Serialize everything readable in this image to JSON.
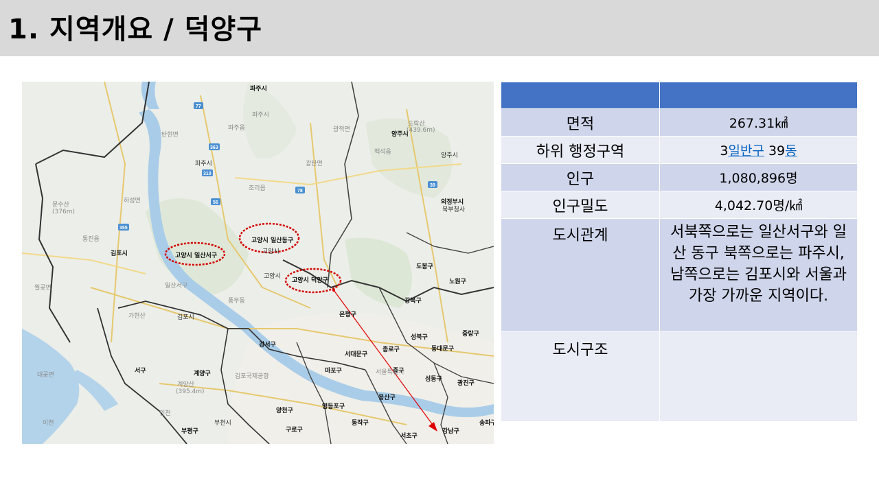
{
  "title": "1. 지역개요 / 덕양구",
  "map": {
    "highlight_labels": [
      "고양시 일산동구",
      "고양시 일산서구",
      "고양시 덕양구"
    ],
    "place_labels": [
      "파주시",
      "파주시",
      "파주읍",
      "광적면",
      "양주시",
      "도락산",
      "(439.6m)",
      "백석읍",
      "양주시",
      "광탄면",
      "탄현면",
      "파주시",
      "조리읍",
      "하성면",
      "문수산",
      "(376m)",
      "통진읍",
      "김포시",
      "고양시",
      "일산서구",
      "고양시",
      "노원구",
      "강북구",
      "도봉구",
      "의정부시",
      "북부청사",
      "은평구",
      "성북구",
      "중랑구",
      "동대문구",
      "종로구",
      "서대문구",
      "마포구",
      "중구",
      "성동구",
      "광진구",
      "용산구",
      "강서구",
      "양천구",
      "영등포구",
      "동작구",
      "구로구",
      "서초구",
      "강남구",
      "송파구",
      "부천시",
      "계양구",
      "부평구",
      "서구",
      "김포시",
      "서울특별시",
      "김포국제공항",
      "계양산",
      "(395.4m)",
      "인천",
      "가현산",
      "대곶면",
      "월곶면",
      "풍무동",
      "이천"
    ],
    "route_numbers": [
      "77",
      "363",
      "310",
      "56",
      "355",
      "78",
      "39"
    ]
  },
  "table": {
    "headers": [
      "",
      ""
    ],
    "rows": {
      "area": {
        "label": "면적",
        "value": "267.31㎢"
      },
      "sub_admin": {
        "label": "하위 행정구역",
        "prefix": "3",
        "link1": "일반구",
        "mid": " 39",
        "link2": "동"
      },
      "population": {
        "label": "인구",
        "value": "1,080,896명"
      },
      "density": {
        "label": "인구밀도",
        "value": "4,042.70명/㎢"
      },
      "relation": {
        "label": "도시관계",
        "value": "서북쪽으로는 일산서구와 일산 동구 북쪽으로는 파주시, 남쪽으로는 김포시와 서울과 가장 가까운 지역이다."
      },
      "structure": {
        "label": "도시구조",
        "value": ""
      }
    }
  },
  "colors": {
    "title_bar": "#d9d9d9",
    "header": "#4472c4",
    "row_dark": "#cfd5ea",
    "row_light": "#e9ebf5",
    "link": "#0563c1",
    "ellipse": "#d40000",
    "arrow": "#e00000"
  }
}
